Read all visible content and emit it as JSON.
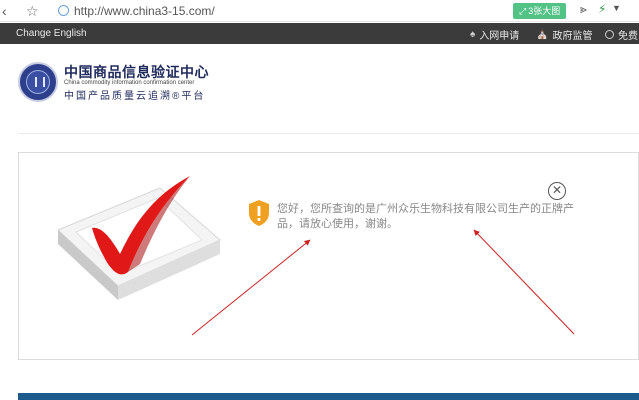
{
  "browser": {
    "url": "http://www.china3-15.com/",
    "image_badge": "3张大图",
    "icons": [
      "back-icon",
      "star-icon",
      "site-icon",
      "share-icon",
      "bolt-icon",
      "caret-down-icon"
    ]
  },
  "topbar": {
    "language_link": "Change English",
    "links": [
      {
        "icon": "user-icon",
        "label": "入网申请"
      },
      {
        "icon": "building-icon",
        "label": "政府监管"
      },
      {
        "icon": "circle-icon",
        "label": "免费"
      }
    ]
  },
  "header": {
    "logo_title": "中国商品信息验证中心",
    "logo_english": "China commodity information confirmation center",
    "logo_subtitle": "中国产品质量云追溯®平台"
  },
  "result": {
    "message": "您好，您所查询的是广州众乐生物科技有限公司生产的正牌产品，请放心使用，谢谢。",
    "icons": [
      "shield-warning-icon",
      "close-icon",
      "checkmark-illustration"
    ]
  },
  "colors": {
    "topbar_bg": "#3b3b3b",
    "badge_green": "#52c285",
    "shield_orange": "#f0a020",
    "check_red": "#e01818",
    "arrow_red": "#cc2222",
    "message_text": "#888888"
  }
}
